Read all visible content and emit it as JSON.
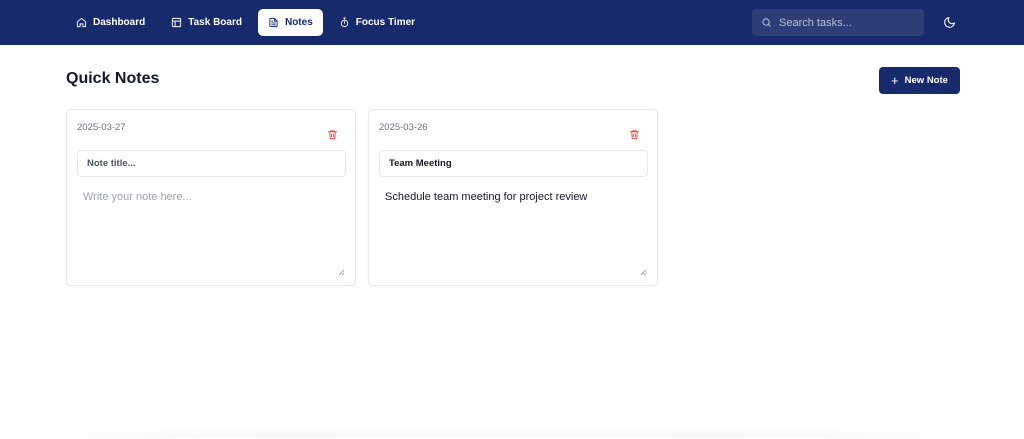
{
  "nav": {
    "items": [
      {
        "label": "Dashboard",
        "icon": "home-icon",
        "active": false
      },
      {
        "label": "Task Board",
        "icon": "layout-icon",
        "active": false
      },
      {
        "label": "Notes",
        "icon": "file-text-icon",
        "active": true
      },
      {
        "label": "Focus Timer",
        "icon": "timer-icon",
        "active": false
      }
    ],
    "search_placeholder": "Search tasks...",
    "theme_icon": "moon-icon"
  },
  "page": {
    "title": "Quick Notes",
    "new_note_label": "New Note"
  },
  "notes": [
    {
      "date": "2025-03-27",
      "title": "",
      "title_placeholder": "Note title...",
      "body": "",
      "body_placeholder": "Write your note here..."
    },
    {
      "date": "2025-03-26",
      "title": "Team Meeting",
      "title_placeholder": "Note title...",
      "body": "Schedule team meeting for project review",
      "body_placeholder": "Write your note here..."
    }
  ],
  "colors": {
    "navbar": "#172a6b",
    "accent": "#172a6b",
    "delete": "#ef4444"
  }
}
